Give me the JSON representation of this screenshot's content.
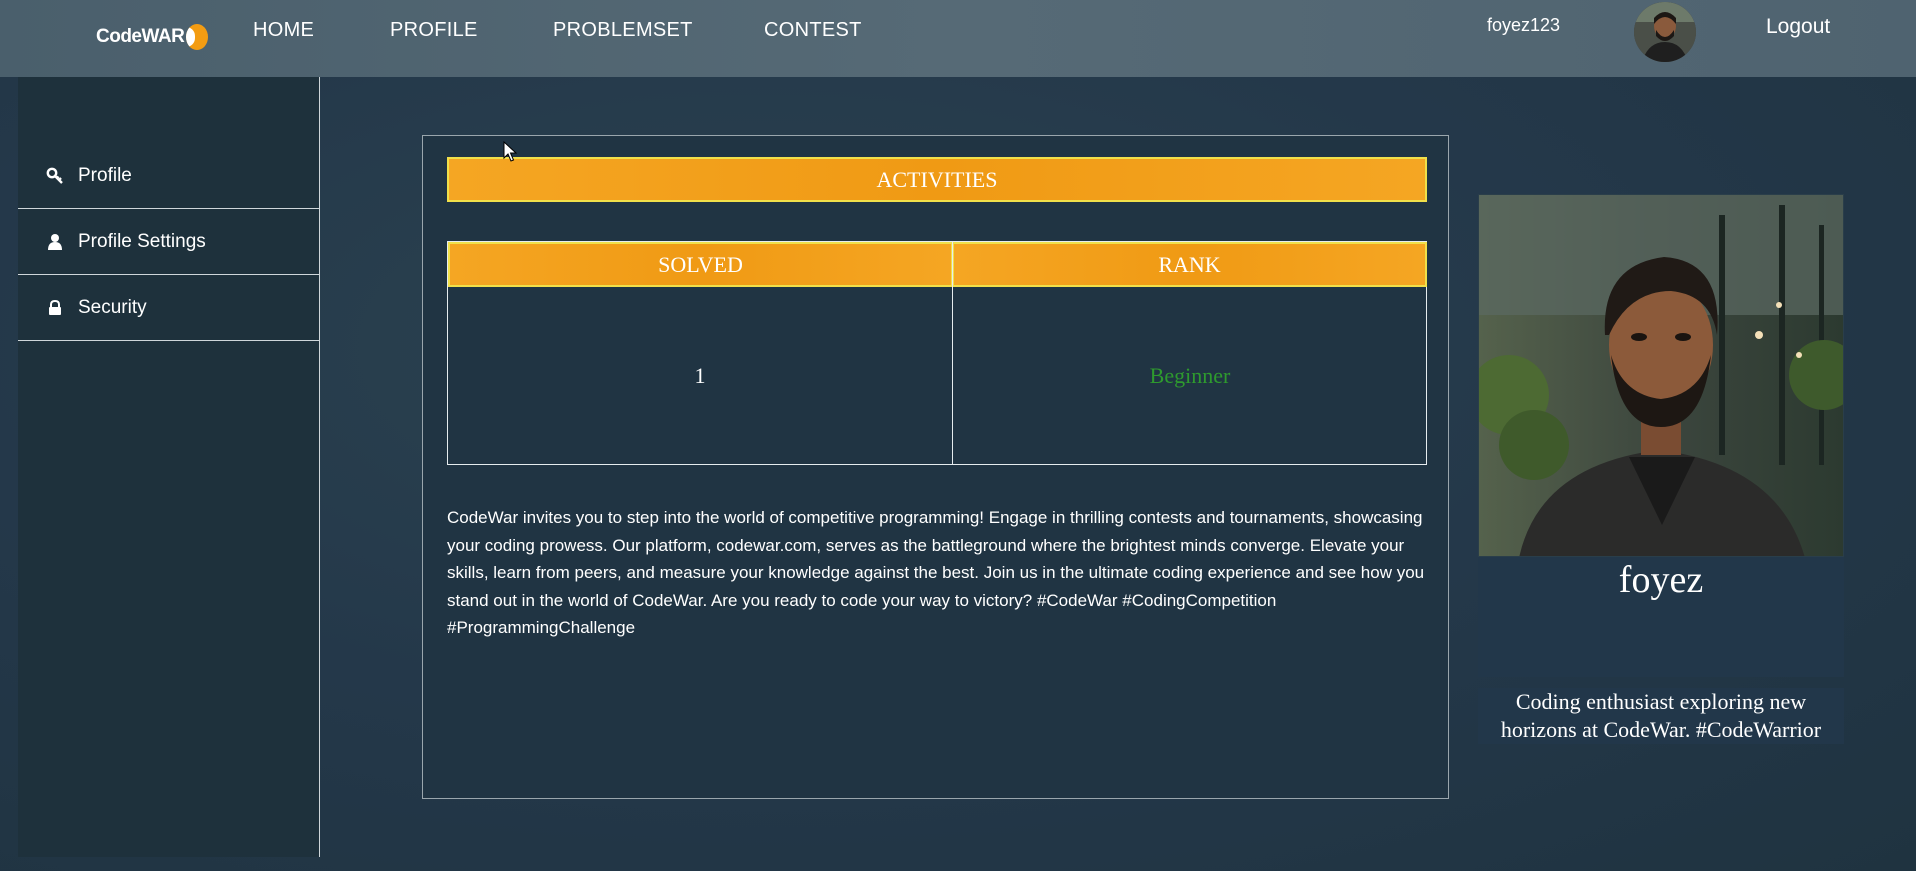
{
  "topbar": {
    "logo_text": "CodeWAR",
    "nav": [
      {
        "label": "HOME"
      },
      {
        "label": "PROFILE"
      },
      {
        "label": "PROBLEMSET"
      },
      {
        "label": "CONTEST"
      }
    ],
    "username": "foyez123",
    "logout_label": "Logout"
  },
  "sidebar": {
    "items": [
      {
        "label": "Profile",
        "icon": "key-icon"
      },
      {
        "label": "Profile Settings",
        "icon": "user-icon"
      },
      {
        "label": "Security",
        "icon": "lock-icon"
      }
    ]
  },
  "main": {
    "activities_title": "ACTIVITIES",
    "stats": {
      "solved_header": "SOLVED",
      "rank_header": "RANK",
      "solved_value": "1",
      "rank_value": "Beginner",
      "rank_color": "#2e9a2e"
    },
    "description": "CodeWar invites you to step into the world of competitive programming! Engage in thrilling contests and tournaments, showcasing your coding prowess. Our platform, codewar.com, serves as the battleground where the brightest minds converge. Elevate your skills, learn from peers, and measure your knowledge against the best. Join us in the ultimate coding experience and see how you stand out in the world of CodeWar. Are you ready to code your way to victory? #CodeWar #CodingCompetition #ProgrammingChallenge"
  },
  "profile_card": {
    "name": "foyez",
    "bio": "Coding enthusiast exploring new horizons at CodeWar. #CodeWarrior"
  },
  "colors": {
    "accent_orange": "#f5a623",
    "accent_border": "#f1e04a",
    "background": "#243a45"
  }
}
